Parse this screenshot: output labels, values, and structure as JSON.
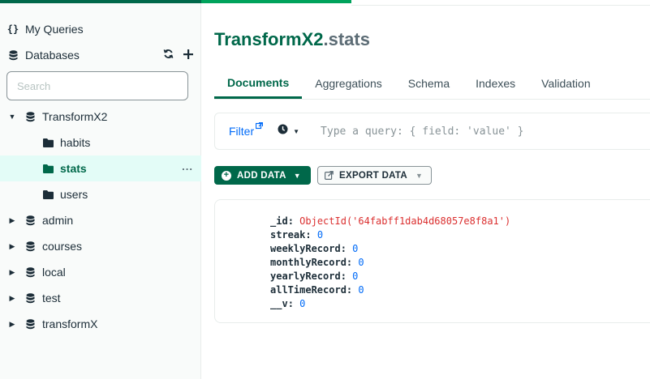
{
  "sidebar": {
    "my_queries_label": "My Queries",
    "databases_label": "Databases",
    "search_placeholder": "Search",
    "databases": [
      {
        "name": "TransformX2",
        "expanded": true,
        "collections": [
          "habits",
          "stats",
          "users"
        ],
        "active_collection": "stats"
      },
      {
        "name": "admin",
        "expanded": false
      },
      {
        "name": "courses",
        "expanded": false
      },
      {
        "name": "local",
        "expanded": false
      },
      {
        "name": "test",
        "expanded": false
      },
      {
        "name": "transformX",
        "expanded": false
      }
    ],
    "more_actions": "..."
  },
  "header": {
    "database": "TransformX2",
    "collection": ".stats"
  },
  "tabs": [
    {
      "label": "Documents",
      "active": true
    },
    {
      "label": "Aggregations",
      "active": false
    },
    {
      "label": "Schema",
      "active": false
    },
    {
      "label": "Indexes",
      "active": false
    },
    {
      "label": "Validation",
      "active": false
    }
  ],
  "filter": {
    "label": "Filter",
    "placeholder": "Type a query: { field: 'value' }"
  },
  "toolbar": {
    "add_data_label": "ADD DATA",
    "export_data_label": "EXPORT DATA"
  },
  "document": {
    "fields": [
      {
        "key": "_id",
        "value": "ObjectId('64fabff1dab4d68057e8f8a1')",
        "type": "objectid"
      },
      {
        "key": "streak",
        "value": "0",
        "type": "number"
      },
      {
        "key": "weeklyRecord",
        "value": "0",
        "type": "number"
      },
      {
        "key": "monthlyRecord",
        "value": "0",
        "type": "number"
      },
      {
        "key": "yearlyRecord",
        "value": "0",
        "type": "number"
      },
      {
        "key": "allTimeRecord",
        "value": "0",
        "type": "number"
      },
      {
        "key": "__v",
        "value": "0",
        "type": "number"
      }
    ]
  },
  "colors": {
    "brand_green": "#00684a",
    "accent_green": "#00a35c",
    "link_blue": "#016bf8",
    "objectid_red": "#db3030"
  }
}
